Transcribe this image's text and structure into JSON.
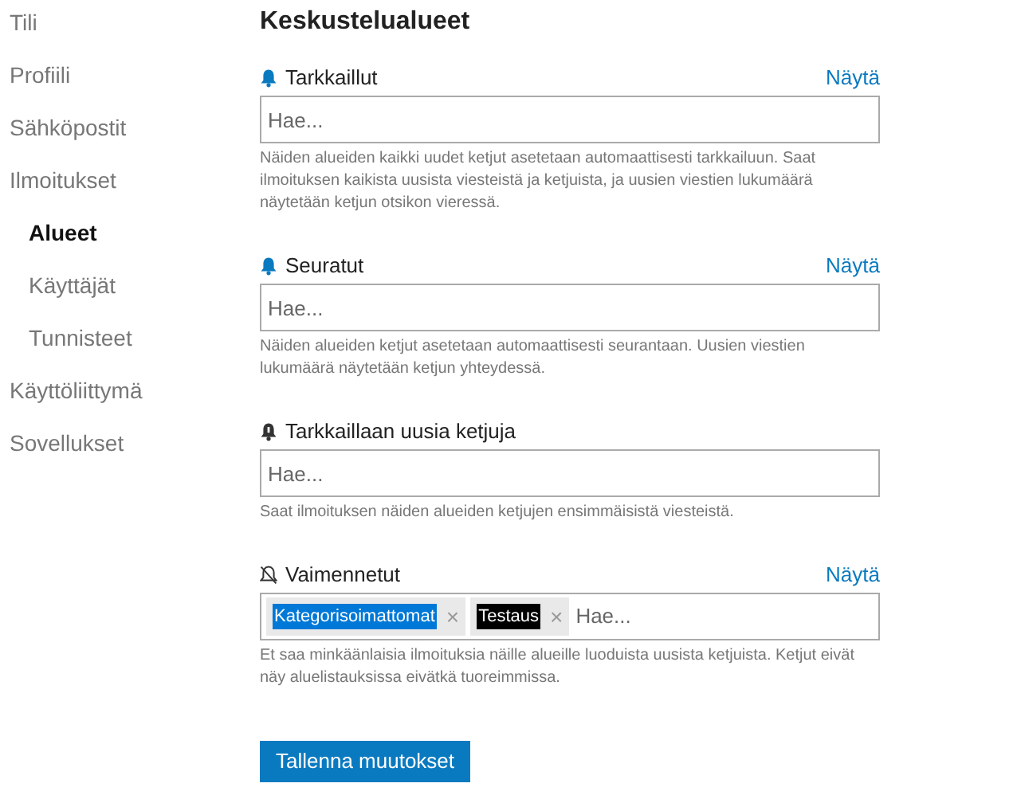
{
  "sidebar": {
    "items": [
      {
        "label": "Tili",
        "selected": false
      },
      {
        "label": "Profiili",
        "selected": false
      },
      {
        "label": "Sähköpostit",
        "selected": false
      },
      {
        "label": "Ilmoitukset",
        "selected": false,
        "children": [
          {
            "label": "Alueet",
            "selected": true
          },
          {
            "label": "Käyttäjät",
            "selected": false
          },
          {
            "label": "Tunnisteet",
            "selected": false
          }
        ]
      },
      {
        "label": "Käyttöliittymä",
        "selected": false
      },
      {
        "label": "Sovellukset",
        "selected": false
      }
    ]
  },
  "title": "Keskustelualueet",
  "sections": [
    {
      "kind": "watching",
      "label": "Tarkkaillut",
      "link": "Näytä",
      "placeholder": "Hae...",
      "help": "Näiden alueiden kaikki uudet ketjut asetetaan automaattisesti tarkkailuun. Saat ilmoituksen kaikista uusista viesteistä ja ketjuista, ja uusien viestien lukumäärä näytetään ketjun otsikon vieressä."
    },
    {
      "kind": "tracking",
      "label": "Seuratut",
      "link": "Näytä",
      "placeholder": "Hae...",
      "help": "Näiden alueiden ketjut asetetaan automaattisesti seurantaan. Uusien viestien lukumäärä näytetään ketjun yhteydessä."
    },
    {
      "kind": "watching_first_post",
      "label": "Tarkkaillaan uusia ketjuja",
      "placeholder": "Hae...",
      "help": "Saat ilmoituksen näiden alueiden ketjujen ensimmäisistä viesteistä."
    },
    {
      "kind": "muted",
      "label": "Vaimennetut",
      "link": "Näytä",
      "placeholder": "Hae...",
      "tags": [
        {
          "label": "Kategorisoimattomat",
          "remove": "×",
          "color": "#0078d7"
        },
        {
          "label": "Testaus",
          "remove": "×",
          "color": "#000000"
        }
      ],
      "help": "Et saa minkäänlaisia ilmoituksia näille alueille luoduista uusista ketjuista. Ketjut eivät näy aluelistauksissa eivätkä tuoreimmissa."
    }
  ],
  "save_button": "Tallenna muutokset"
}
